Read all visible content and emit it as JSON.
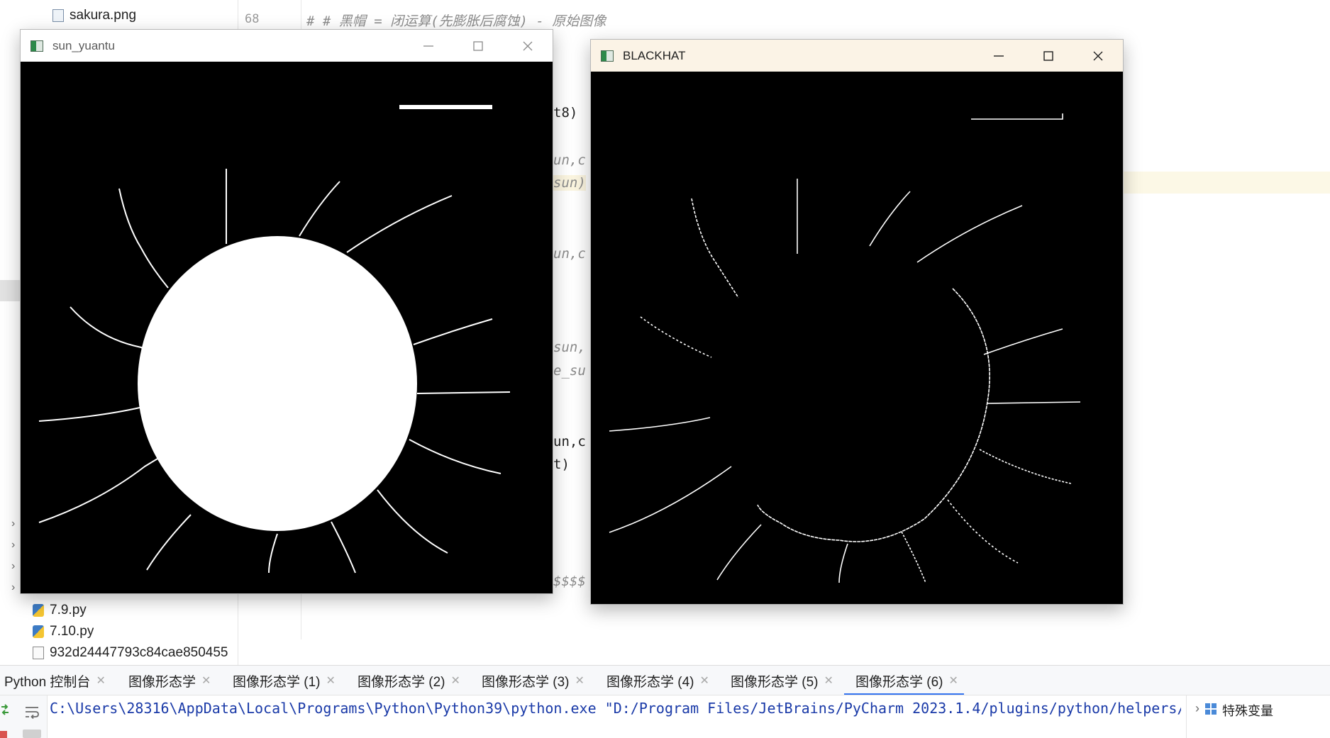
{
  "project_tree": {
    "items_top": [
      {
        "label": "sakura.png",
        "icon": "image-file-icon"
      }
    ],
    "items_bottom": [
      {
        "label": "7.9.py",
        "icon": "python-file-icon"
      },
      {
        "label": "7.10.py",
        "icon": "python-file-icon"
      },
      {
        "label": "932d24447793c84cae850455",
        "icon": "file-icon"
      }
    ]
  },
  "editor": {
    "line_numbers": [
      "68"
    ],
    "comment_line": "# # 黑帽 = 闭运算(先膨胀后腐蚀) - 原始图像",
    "fragments": [
      "t8)",
      "un,c",
      "sun)",
      "un,c",
      "sun,",
      "e_su",
      "un,c",
      "t)",
      "$$$$"
    ]
  },
  "windows": {
    "left": {
      "title": "sun_yuantu",
      "icon": "opencv-window-icon"
    },
    "right": {
      "title": "BLACKHAT",
      "icon": "opencv-window-icon"
    }
  },
  "tabs": [
    {
      "label": "Python 控制台",
      "active": false
    },
    {
      "label": "图像形态学",
      "active": false
    },
    {
      "label": "图像形态学 (1)",
      "active": false
    },
    {
      "label": "图像形态学 (2)",
      "active": false
    },
    {
      "label": "图像形态学 (3)",
      "active": false
    },
    {
      "label": "图像形态学 (4)",
      "active": false
    },
    {
      "label": "图像形态学 (5)",
      "active": false
    },
    {
      "label": "图像形态学 (6)",
      "active": true
    }
  ],
  "console": {
    "command": "C:\\Users\\28316\\AppData\\Local\\Programs\\Python\\Python39\\python.exe \"D:/Program Files/JetBrains/PyCharm 2023.1.4/plugins/python/helpers/",
    "variables_label": "特殊变量"
  },
  "colors": {
    "accent": "#3574f0",
    "console_text": "#1a3aa8",
    "left_titlebar": "#ffffff",
    "right_titlebar": "#fbf3e6"
  }
}
